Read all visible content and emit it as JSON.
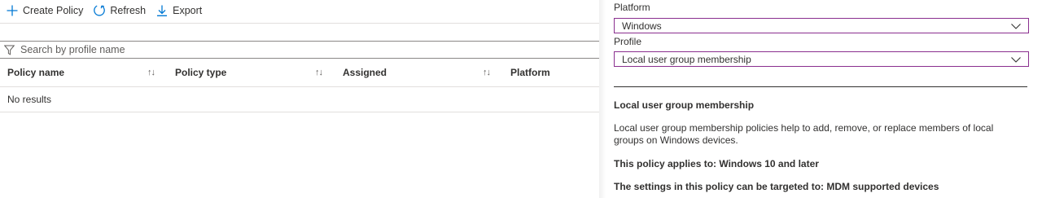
{
  "toolbar": {
    "create_label": "Create Policy",
    "refresh_label": "Refresh",
    "export_label": "Export"
  },
  "search": {
    "placeholder": "Search by profile name"
  },
  "table": {
    "columns": [
      "Policy name",
      "Policy type",
      "Assigned",
      "Platform"
    ],
    "empty_text": "No results"
  },
  "panel": {
    "platform_label": "Platform",
    "platform_value": "Windows",
    "profile_label": "Profile",
    "profile_value": "Local user group membership",
    "title": "Local user group membership",
    "description": "Local user group membership policies help to add, remove, or replace members of local groups on Windows devices.",
    "applies_to": "This policy applies to: Windows 10 and later",
    "targeted_to": "The settings in this policy can be targeted to: MDM supported devices"
  },
  "colors": {
    "accent": "#0078d4",
    "select_border": "#8a2f8f",
    "text": "#323130"
  }
}
